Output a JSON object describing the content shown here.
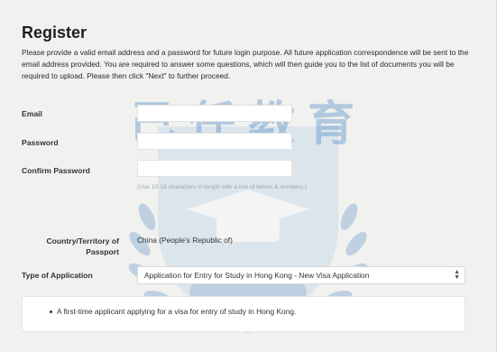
{
  "form": {
    "title": "Register",
    "intro": "Please provide a valid email address and a password for future login purpose. All future application correspondence will be sent to the email address provided. You are required to answer some questions, which will then guide you to the list of documents you will be required to upload. Please then click \"Next\" to further proceed.",
    "email_label": "Email",
    "password_label": "Password",
    "confirm_password_label": "Confirm Password",
    "password_hint": "(Use 10-18 characters in length with a mix of letters & numbers.)",
    "country_label_line1": "Country/Territory of",
    "country_label_line2": "Passport",
    "country_value": "China (People's Republic of)",
    "application_type_label": "Type of Application",
    "application_type_value": "Application for Entry for Study in Hong Kong - New Visa Application",
    "application_note": "A first-time applicant applying for a visa for entry of study in Hong Kong."
  },
  "watermark": {
    "text": "己任教育",
    "color": "#3d7fc4"
  }
}
